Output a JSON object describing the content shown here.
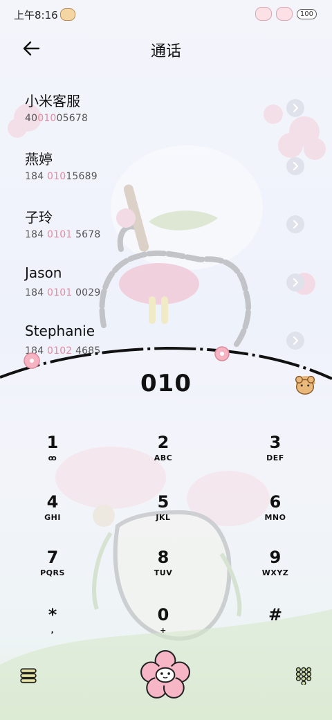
{
  "status_bar": {
    "time": "上午8:16",
    "battery": "100"
  },
  "header": {
    "title": "通话"
  },
  "contacts": [
    {
      "name": "小米客服",
      "num_pre": "40",
      "num_hl": "010",
      "num_post": "05678"
    },
    {
      "name": "燕婷",
      "num_pre": "184 ",
      "num_hl": "010",
      "num_post": "15689"
    },
    {
      "name": "子玲",
      "num_pre": "184 ",
      "num_hl": "0101",
      "num_post": " 5678"
    },
    {
      "name": "Jason",
      "num_pre": "184 ",
      "num_hl": "0101",
      "num_post": " 0029"
    },
    {
      "name": "Stephanie",
      "num_pre": "184 ",
      "num_hl": "0102",
      "num_post": " 4685"
    }
  ],
  "dialer": {
    "input": "010"
  },
  "keypad": [
    {
      "digit": "1",
      "letters": "ꝏ"
    },
    {
      "digit": "2",
      "letters": "ABC"
    },
    {
      "digit": "3",
      "letters": "DEF"
    },
    {
      "digit": "4",
      "letters": "GHI"
    },
    {
      "digit": "5",
      "letters": "JKL"
    },
    {
      "digit": "6",
      "letters": "MNO"
    },
    {
      "digit": "7",
      "letters": "PQRS"
    },
    {
      "digit": "8",
      "letters": "TUV"
    },
    {
      "digit": "9",
      "letters": "WXYZ"
    },
    {
      "digit": "*",
      "letters": ","
    },
    {
      "digit": "0",
      "letters": "+"
    },
    {
      "digit": "#",
      "letters": ""
    }
  ],
  "icons": {
    "back": "back-arrow-icon",
    "menu": "menu-icon",
    "call": "call-button-icon",
    "keypad_toggle": "keypad-grid-icon",
    "chevron": "chevron-right-icon"
  },
  "colors": {
    "highlight": "#e58aa1",
    "accent_pink": "#f7b6c6"
  }
}
